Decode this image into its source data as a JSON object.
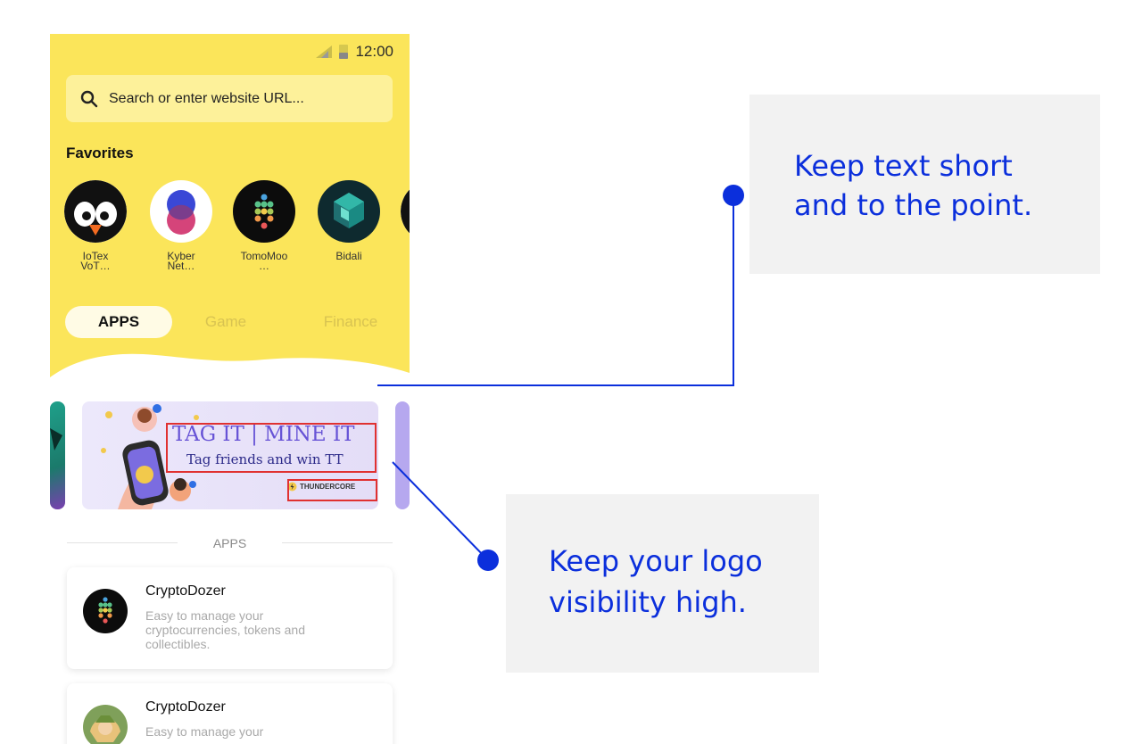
{
  "status_bar": {
    "time": "12:00"
  },
  "search": {
    "placeholder": "Search or enter website URL..."
  },
  "favorites": {
    "title": "Favorites",
    "items": [
      {
        "label": "IoTex\nVoT…",
        "icon": "penguin-icon"
      },
      {
        "label": "Kyber\nNet…",
        "icon": "kyber-icon"
      },
      {
        "label": "TomoMoo\n…",
        "icon": "dots-icon"
      },
      {
        "label": "Bidali",
        "icon": "bidali-icon"
      }
    ]
  },
  "tabs": [
    {
      "label": "APPS",
      "active": true
    },
    {
      "label": "Game",
      "active": false
    },
    {
      "label": "Finance",
      "active": false
    }
  ],
  "banner": {
    "headline": "TAG IT | MINE IT",
    "subline": "Tag friends and win TT",
    "logo_text": "THUNDERCORE"
  },
  "section_label": "APPS",
  "apps": [
    {
      "name": "CryptoDozer",
      "desc": "Easy to manage your cryptocurrencies, tokens and collectibles."
    },
    {
      "name": "CryptoDozer",
      "desc": "Easy to manage your"
    }
  ],
  "callouts": [
    {
      "text": "Keep text short\nand to the point."
    },
    {
      "text": "Keep your logo\nvisibility high."
    }
  ],
  "colors": {
    "yellow": "#fbe55a",
    "accent": "#0b2fdc",
    "highlight_box": "#e03131"
  }
}
